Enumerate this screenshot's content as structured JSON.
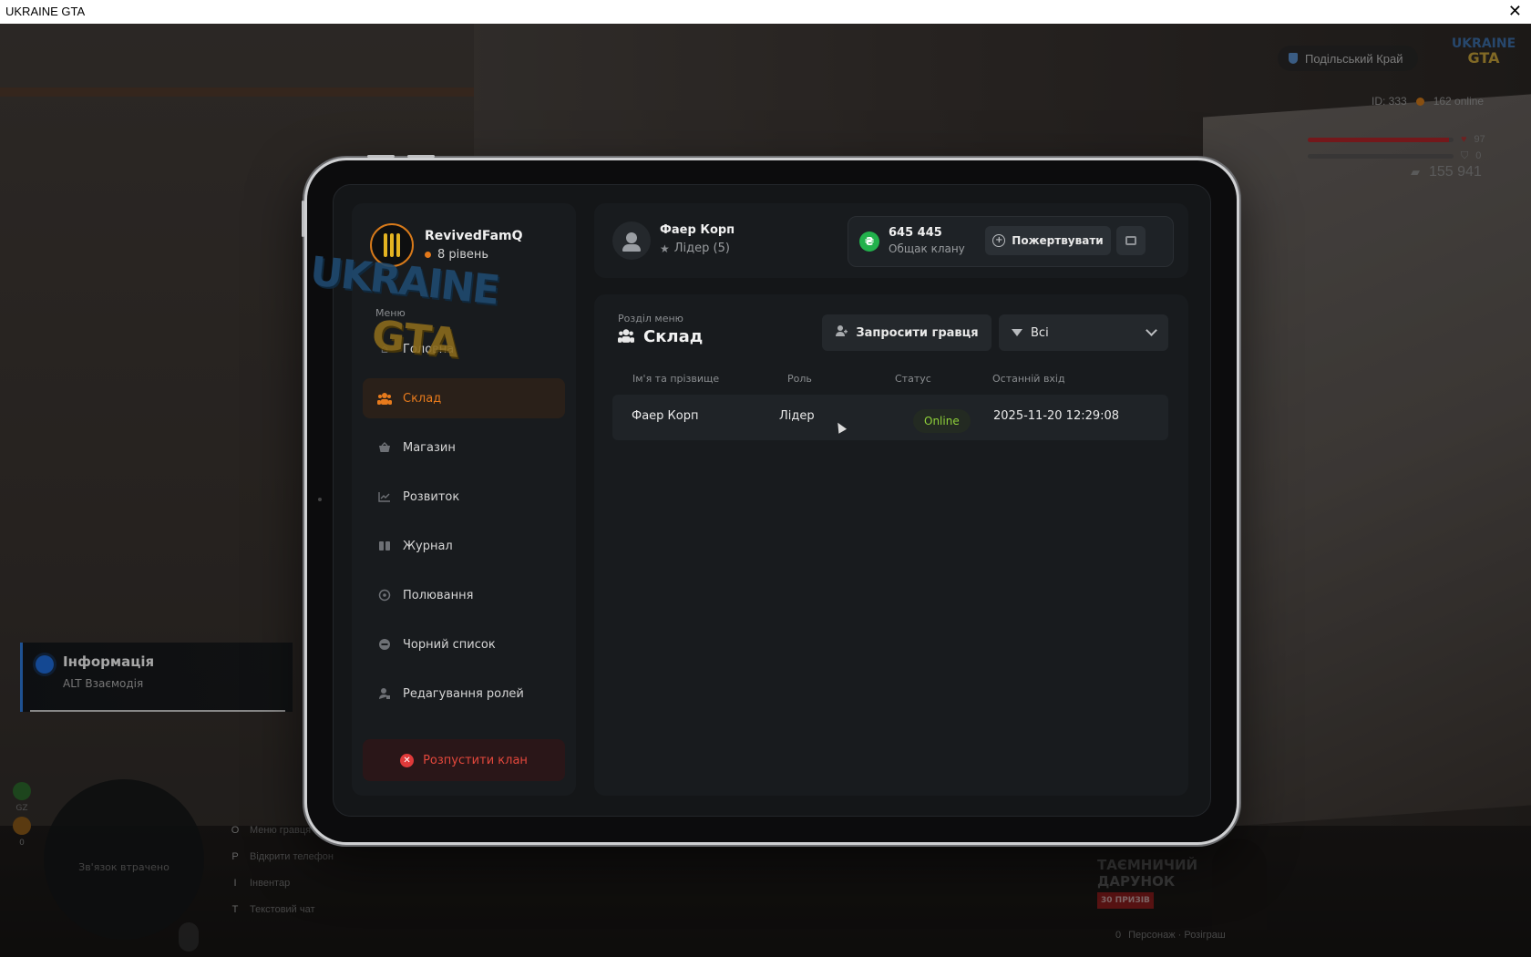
{
  "window": {
    "title": "UKRAINE GTA",
    "close_glyph": "✕"
  },
  "hud": {
    "region": "Подільський Край",
    "logo_top": "UKRAINE",
    "logo_bottom": "GTA",
    "id_text": "ID: 333",
    "online_text": "162 online",
    "health": 97,
    "armor": 0,
    "money": "155 941",
    "colors": {
      "health": "#b3262a",
      "armor": "#555555",
      "online_dot": "#d27a1b"
    }
  },
  "toast": {
    "title": "Інформація",
    "text": "ALT Взаємодія"
  },
  "minimap": {
    "status": "Зв'язок втрачено",
    "side_label": "GZ",
    "side_count": "0"
  },
  "keys": [
    {
      "key": "O",
      "label": "Меню гравця"
    },
    {
      "key": "P",
      "label": "Відкрити телефон"
    },
    {
      "key": "I",
      "label": "Інвентар"
    },
    {
      "key": "T",
      "label": "Текстовий чат"
    }
  ],
  "gift": {
    "line1": "ТАЄМНИЧИЙ",
    "line2": "ДАРУНОК",
    "badge": "30 ПРИЗІВ",
    "footer_key": "0",
    "footer": "Персонаж · Розіграш"
  },
  "clan": {
    "name": "RevivedFamQ",
    "level": "8 рівень",
    "accent": "#e77a1c"
  },
  "sidebar": {
    "caption": "Меню",
    "items": [
      {
        "label": "Головна",
        "icon": "home-icon",
        "glyph": "⌂",
        "active": false
      },
      {
        "label": "Склад",
        "icon": "people-icon",
        "glyph": "👥",
        "active": true
      },
      {
        "label": "Магазин",
        "icon": "basket-icon",
        "glyph": "🧺",
        "active": false
      },
      {
        "label": "Розвиток",
        "icon": "chart-icon",
        "glyph": "📈",
        "active": false
      },
      {
        "label": "Журнал",
        "icon": "book-icon",
        "glyph": "▮▮",
        "active": false
      },
      {
        "label": "Полювання",
        "icon": "crosshair-icon",
        "glyph": "⊕",
        "active": false
      },
      {
        "label": "Чорний список",
        "icon": "minus-circle-icon",
        "glyph": "⊖",
        "active": false
      },
      {
        "label": "Редагування ролей",
        "icon": "user-edit-icon",
        "glyph": "👤",
        "active": false
      }
    ],
    "disband_label": "Розпустити клан"
  },
  "header": {
    "leader_name": "Фаер Корп",
    "leader_role": "Лідер (5)",
    "bank_amount": "645 445",
    "bank_label": "Общак клану",
    "bank_currency": "₴",
    "donate_label": "Пожертвувати"
  },
  "main": {
    "section_caption": "Розділ меню",
    "section_title": "Склад",
    "invite_label": "Запросити гравця",
    "filter_value": "Всі",
    "columns": [
      "Ім'я та прізвище",
      "Роль",
      "Статус",
      "Останній вхід"
    ],
    "rows": [
      {
        "name": "Фаер Корп",
        "role": "Лідер",
        "status": "Online",
        "last_login": "2025-11-20 12:29:08"
      }
    ],
    "watermark_top": "UKRAINE",
    "watermark_bottom": "GTA"
  }
}
